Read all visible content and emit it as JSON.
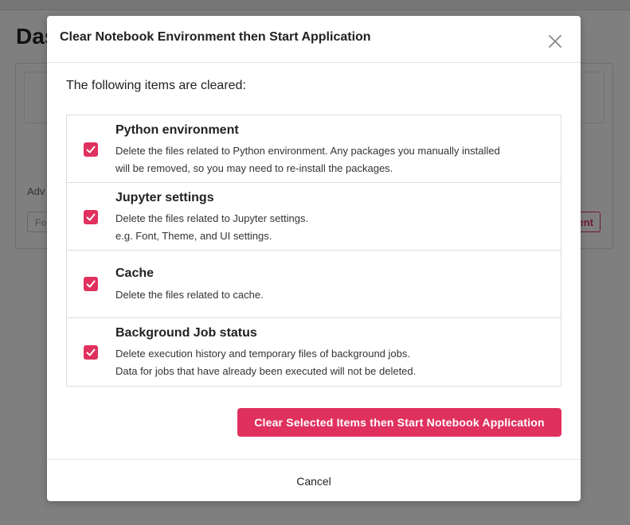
{
  "background": {
    "page_title": "Das",
    "advanced_label": "Adv",
    "input_placeholder": "Fo",
    "button_label": "ent"
  },
  "modal": {
    "title": "Clear Notebook Environment then Start Application",
    "close_icon": "close-icon",
    "intro": "The following items are cleared:",
    "items": [
      {
        "checked": true,
        "title": "Python environment",
        "desc": [
          "Delete the files related to Python environment. Any packages you manually installed",
          "will be removed, so you may need to re-install the packages."
        ]
      },
      {
        "checked": true,
        "title": "Jupyter settings",
        "desc": [
          "Delete the files related to Jupyter settings.",
          "e.g. Font, Theme, and UI settings."
        ]
      },
      {
        "checked": true,
        "title": "Cache",
        "desc": [
          "Delete the files related to cache.",
          ""
        ]
      },
      {
        "checked": true,
        "title": "Background Job status",
        "desc": [
          "Delete execution history and temporary files of background jobs.",
          "Data for jobs that have already been executed will not be deleted."
        ]
      }
    ],
    "primary_button": "Clear Selected Items then Start Notebook Application",
    "cancel_button": "Cancel"
  },
  "colors": {
    "accent": "#e0315e",
    "overlay": "rgba(0,0,0,0.5)"
  }
}
